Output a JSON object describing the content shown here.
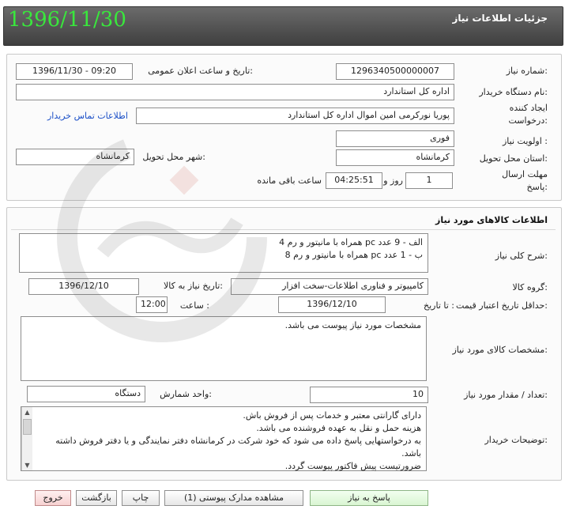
{
  "header": {
    "title": "جزئیات اطلاعات نیاز",
    "date": "1396/11/30"
  },
  "info": {
    "need_number_label": "شماره نیاز:",
    "need_number": "1296340500000007",
    "announce_label": "تاریخ و ساعت اعلان عمومی:",
    "announce_value": "1396/11/30 - 09:20",
    "buyer_org_label": "نام دستگاه خریدار:",
    "buyer_org": "اداره کل استاندارد",
    "creator_label_1": "ایجاد کننده",
    "creator_label_2": "درخواست:",
    "creator": "پوریا نورکرمی امین اموال اداره کل استاندارد",
    "contact_link": "اطلاعات تماس خریدار",
    "priority_label": "اولویت نیاز :",
    "priority": "فوری",
    "province_label": "استان محل تحویل:",
    "province": "کرمانشاه",
    "city_label": "شهر محل تحویل:",
    "city": "کرمانشاه",
    "deadline_label_1": "مهلت ارسال",
    "deadline_label_2": "پاسخ:",
    "days": "1",
    "day_word": "روز و",
    "time_left": "04:25:51",
    "remaining_word": "ساعت باقی مانده"
  },
  "goods": {
    "section_title": "اطلاعات کالاهای مورد نیاز",
    "general_desc_label": "شرح کلی نیاز:",
    "general_desc_lines": [
      "الف - 9 عدد pc همراه با مانیتور و رم 4",
      "ب - 1 عدد pc همراه با مانیتور و رم 8"
    ],
    "group_label": "گروه کالا:",
    "group": "کامپیوتر و فناوری اطلاعات-سخت افزار",
    "need_date_label": "تاریخ نیاز به کالا:",
    "need_date": "1396/12/10",
    "min_validity_label": "حداقل تاریخ اعتبار قیمت:",
    "until_date_label": "تا تاریخ :",
    "until_date": "1396/12/10",
    "hour_label": "ساعت :",
    "hour": "12:00",
    "specs_label": "مشخصات کالای مورد نیاز:",
    "specs": "مشخصات مورد نیاز پیوست می باشد.",
    "qty_label": "تعداد / مقدار مورد نیاز:",
    "qty": "10",
    "unit_label": "واحد شمارش:",
    "unit": "دستگاه",
    "buyer_notes_label": "توضیحات خریدار:",
    "buyer_notes_lines": [
      "دارای گارانتی معتبر و خدمات پس از فروش باش.",
      "هزینه حمل و نقل به عهده فروشنده می باشد.",
      "به درخواستهایی پاسخ داده می شود که خود شرکت در کرمانشاه دفتر نمایندگی و یا دفتر فروش داشته باشد.",
      "ضرورتیست پیش فاکتور پیوست گردد."
    ]
  },
  "buttons": {
    "reply": "پاسخ به نیاز",
    "attachments": "مشاهده مدارک پیوستی (1)",
    "print": "چاپ",
    "back": "بازگشت",
    "exit": "خروج"
  }
}
